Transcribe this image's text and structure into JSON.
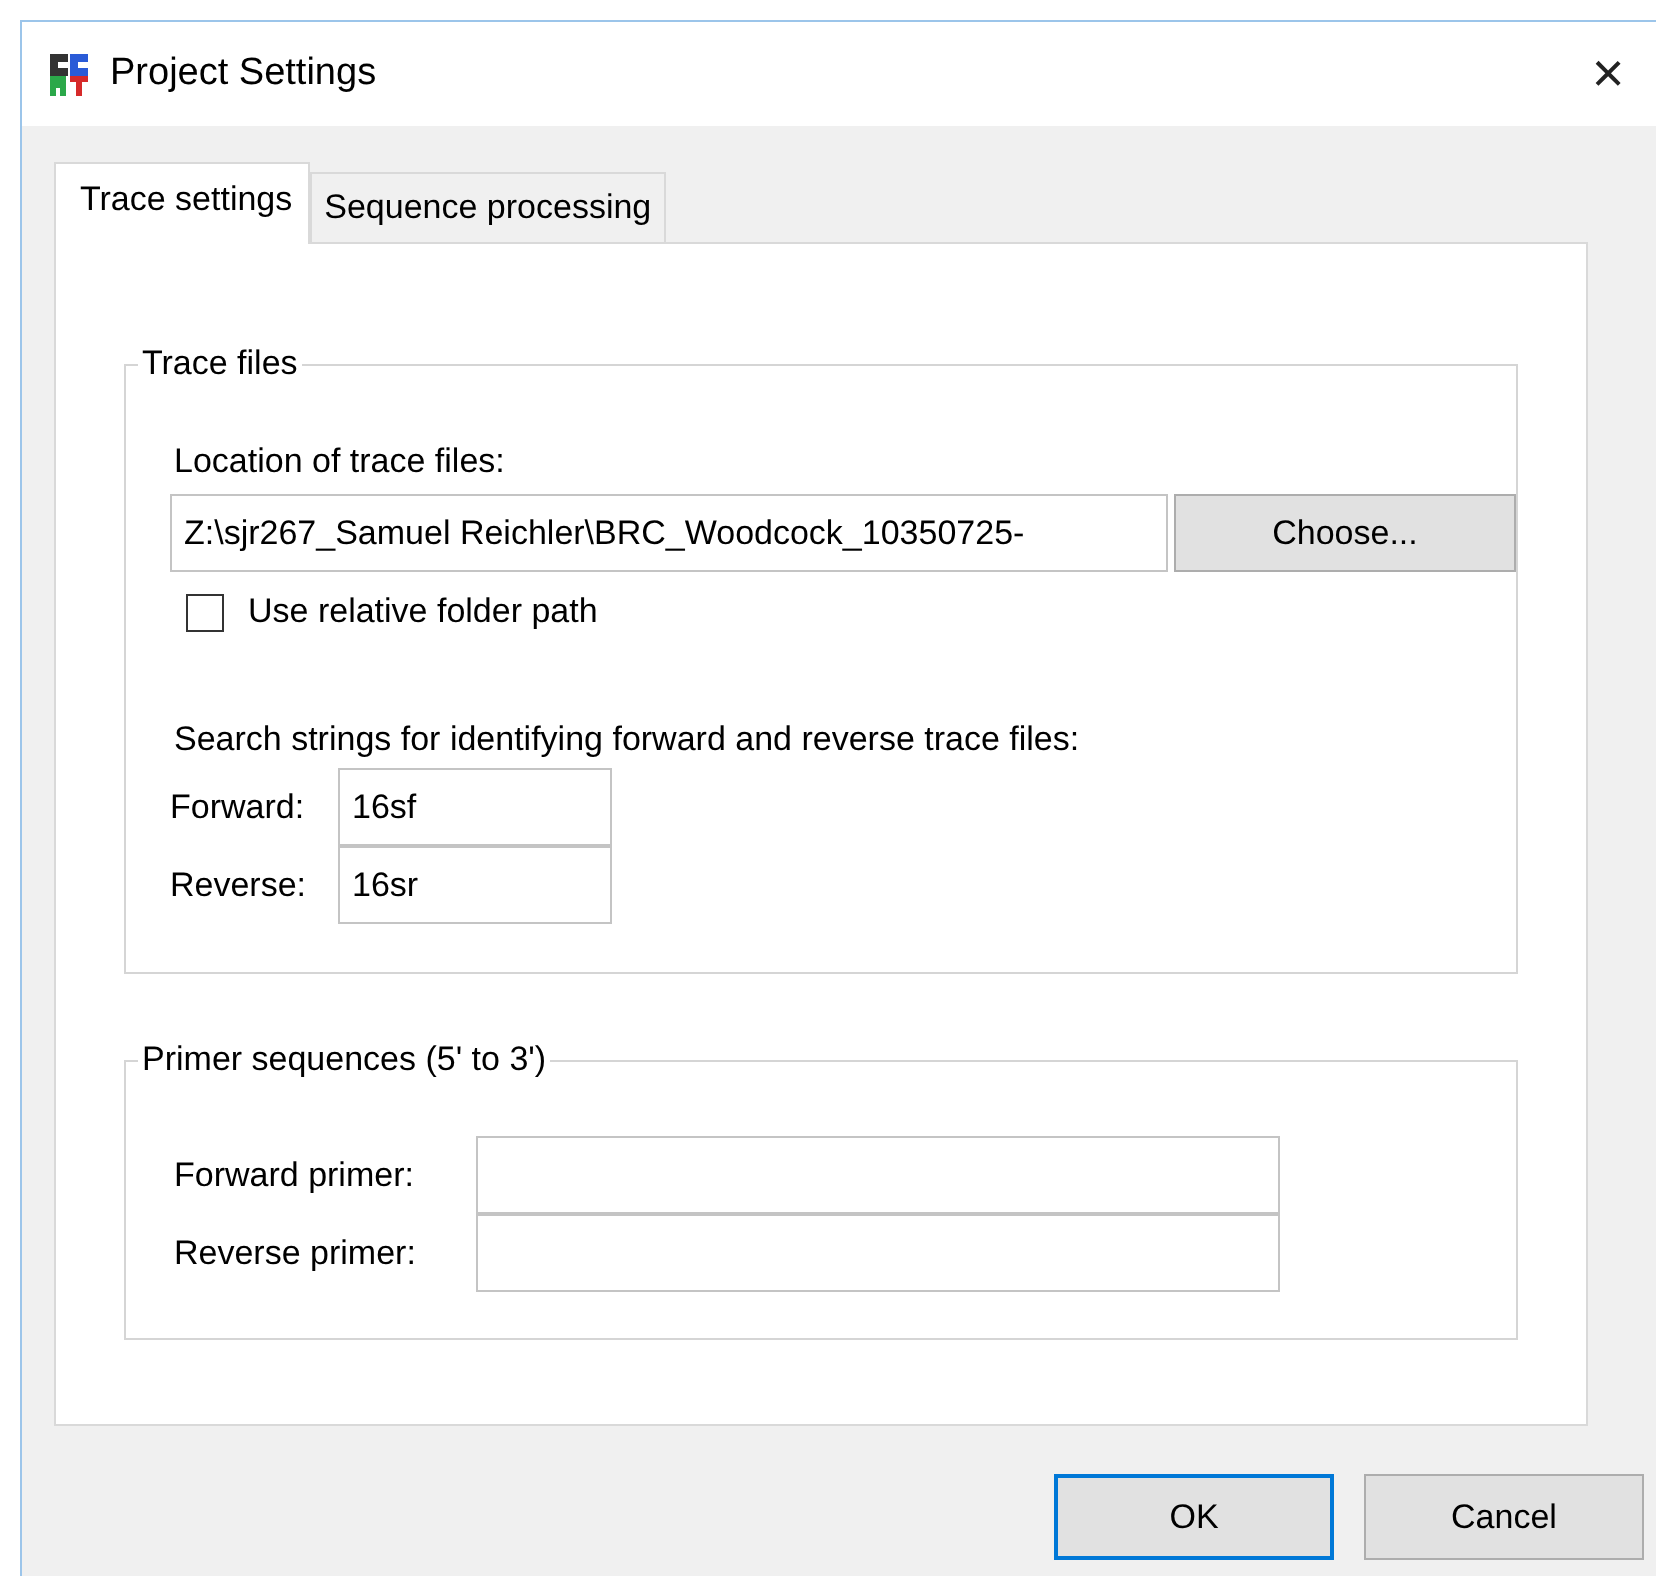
{
  "window": {
    "title": "Project Settings",
    "close": "×"
  },
  "tabs": [
    {
      "label": "Trace settings",
      "selected": true
    },
    {
      "label": "Sequence processing",
      "selected": false
    }
  ],
  "trace_files": {
    "title": "Trace files",
    "location_label": "Location of trace files:",
    "location_value": "Z:\\sjr267_Samuel Reichler\\BRC_Woodcock_10350725-",
    "choose_button": "Choose...",
    "relative_path": {
      "label": "Use relative folder path",
      "checked": false
    },
    "search_label": "Search strings for identifying forward and reverse trace files:",
    "fields": [
      {
        "label": "Forward:",
        "value": "16sf"
      },
      {
        "label": "Reverse:",
        "value": "16sr"
      }
    ]
  },
  "primers": {
    "title": "Primer sequences (5' to 3')",
    "fields": [
      {
        "label": "Forward primer:"
      },
      {
        "label": "Reverse primer:"
      }
    ]
  },
  "buttons": [
    {
      "label": "OK",
      "default": true
    },
    {
      "label": "Cancel",
      "default": false
    }
  ]
}
